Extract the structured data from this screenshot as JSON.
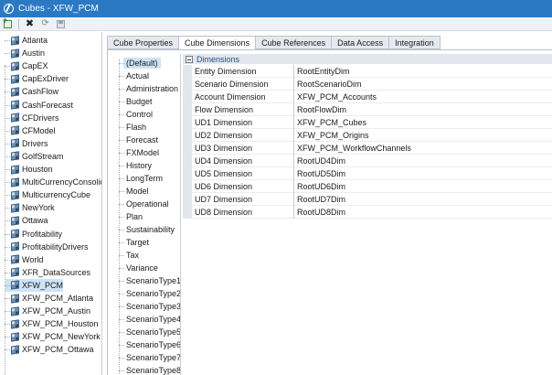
{
  "window": {
    "title": "Cubes - XFW_PCM"
  },
  "toolbar": {
    "icons": [
      "new-icon",
      "delete-icon",
      "refresh-icon",
      "save-icon"
    ]
  },
  "cube_tree": {
    "items": [
      {
        "label": "Atlanta"
      },
      {
        "label": "Austin"
      },
      {
        "label": "CapEX"
      },
      {
        "label": "CapExDriver"
      },
      {
        "label": "CashFlow"
      },
      {
        "label": "CashForecast"
      },
      {
        "label": "CFDrivers"
      },
      {
        "label": "CFModel"
      },
      {
        "label": "Drivers"
      },
      {
        "label": "GolfStream"
      },
      {
        "label": "Houston"
      },
      {
        "label": "MultiCurrencyConsolidation"
      },
      {
        "label": "MulticurrencyCube"
      },
      {
        "label": "NewYork"
      },
      {
        "label": "Ottawa"
      },
      {
        "label": "Profitability"
      },
      {
        "label": "ProfitabilityDrivers"
      },
      {
        "label": "World"
      },
      {
        "label": "XFR_DataSources"
      },
      {
        "label": "XFW_PCM",
        "selected": true
      },
      {
        "label": "XFW_PCM_Atlanta"
      },
      {
        "label": "XFW_PCM_Austin"
      },
      {
        "label": "XFW_PCM_Houston"
      },
      {
        "label": "XFW_PCM_NewYork"
      },
      {
        "label": "XFW_PCM_Ottawa"
      }
    ]
  },
  "tabs": [
    {
      "label": "Cube Properties"
    },
    {
      "label": "Cube Dimensions",
      "active": true
    },
    {
      "label": "Cube References"
    },
    {
      "label": "Data Access"
    },
    {
      "label": "Integration"
    }
  ],
  "scenario_types": [
    {
      "label": "(Default)",
      "selected": true
    },
    {
      "label": "Actual"
    },
    {
      "label": "Administration"
    },
    {
      "label": "Budget"
    },
    {
      "label": "Control"
    },
    {
      "label": "Flash"
    },
    {
      "label": "Forecast"
    },
    {
      "label": "FXModel"
    },
    {
      "label": "History"
    },
    {
      "label": "LongTerm"
    },
    {
      "label": "Model"
    },
    {
      "label": "Operational"
    },
    {
      "label": "Plan"
    },
    {
      "label": "Sustainability"
    },
    {
      "label": "Target"
    },
    {
      "label": "Tax"
    },
    {
      "label": "Variance"
    },
    {
      "label": "ScenarioType1"
    },
    {
      "label": "ScenarioType2"
    },
    {
      "label": "ScenarioType3"
    },
    {
      "label": "ScenarioType4"
    },
    {
      "label": "ScenarioType5"
    },
    {
      "label": "ScenarioType6"
    },
    {
      "label": "ScenarioType7"
    },
    {
      "label": "ScenarioType8"
    }
  ],
  "dimensions": {
    "section_label": "Dimensions",
    "rows": [
      {
        "name": "Entity Dimension",
        "value": "RootEntityDim"
      },
      {
        "name": "Scenario Dimension",
        "value": "RootScenarioDim"
      },
      {
        "name": "Account Dimension",
        "value": "XFW_PCM_Accounts"
      },
      {
        "name": "Flow Dimension",
        "value": "RootFlowDim"
      },
      {
        "name": "UD1 Dimension",
        "value": "XFW_PCM_Cubes"
      },
      {
        "name": "UD2 Dimension",
        "value": "XFW_PCM_Origins"
      },
      {
        "name": "UD3 Dimension",
        "value": "XFW_PCM_WorkflowChannels"
      },
      {
        "name": "UD4 Dimension",
        "value": "RootUD4Dim"
      },
      {
        "name": "UD5 Dimension",
        "value": "RootUD5Dim"
      },
      {
        "name": "UD6 Dimension",
        "value": "RootUD6Dim"
      },
      {
        "name": "UD7 Dimension",
        "value": "RootUD7Dim"
      },
      {
        "name": "UD8 Dimension",
        "value": "RootUD8Dim"
      }
    ]
  }
}
